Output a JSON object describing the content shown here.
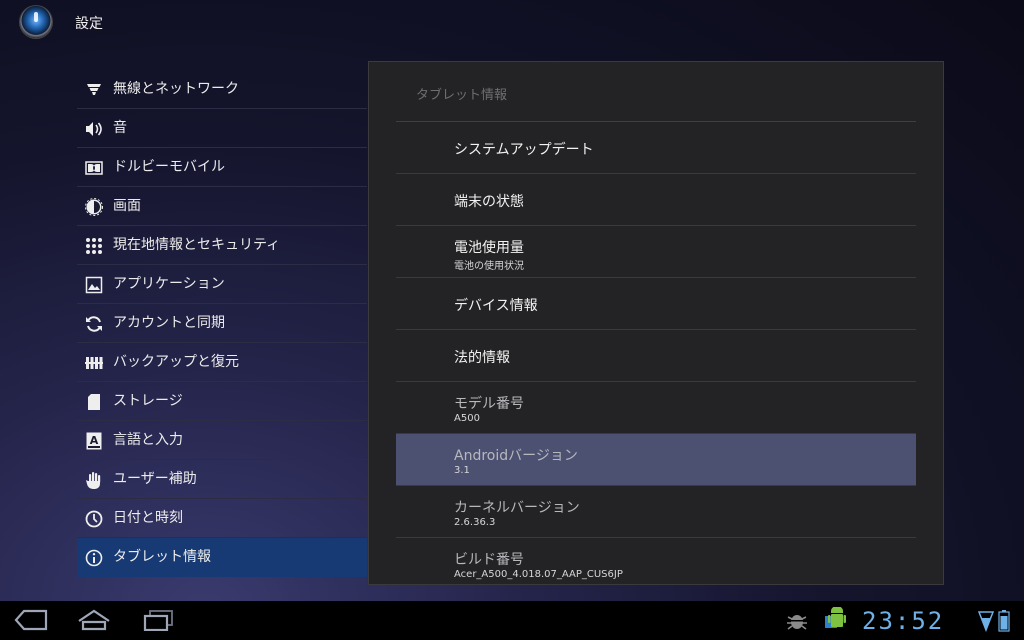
{
  "app": {
    "title": "設定"
  },
  "menu": {
    "items": [
      {
        "label": "無線とネットワーク",
        "icon": "wifi-icon"
      },
      {
        "label": "音",
        "icon": "speaker-icon"
      },
      {
        "label": "ドルビーモバイル",
        "icon": "dolby-icon"
      },
      {
        "label": "画面",
        "icon": "brightness-icon"
      },
      {
        "label": "現在地情報とセキュリティ",
        "icon": "location-grid-icon"
      },
      {
        "label": "アプリケーション",
        "icon": "applications-icon"
      },
      {
        "label": "アカウントと同期",
        "icon": "sync-icon"
      },
      {
        "label": "バックアップと復元",
        "icon": "backup-icon"
      },
      {
        "label": "ストレージ",
        "icon": "sd-card-icon"
      },
      {
        "label": "言語と入力",
        "icon": "keyboard-a-icon"
      },
      {
        "label": "ユーザー補助",
        "icon": "hand-icon"
      },
      {
        "label": "日付と時刻",
        "icon": "clock-icon"
      },
      {
        "label": "タブレット情報",
        "icon": "info-icon",
        "selected": true
      }
    ]
  },
  "panel": {
    "header": "タブレット情報",
    "rows": [
      {
        "title": "システムアップデート",
        "sub": ""
      },
      {
        "title": "端末の状態",
        "sub": ""
      },
      {
        "title": "電池使用量",
        "sub": "電池の使用状況"
      },
      {
        "title": "デバイス情報",
        "sub": ""
      },
      {
        "title": "法的情報",
        "sub": ""
      },
      {
        "title": "モデル番号",
        "sub": "A500"
      },
      {
        "title": "Androidバージョン",
        "sub": "3.1",
        "highlight": true
      },
      {
        "title": "カーネルバージョン",
        "sub": "2.6.36.3"
      },
      {
        "title": "ビルド番号",
        "sub": "Acer_A500_4.018.07_AAP_CUS6JP"
      }
    ]
  },
  "systembar": {
    "clock": "23:52",
    "accent": "#6fb0e6"
  }
}
